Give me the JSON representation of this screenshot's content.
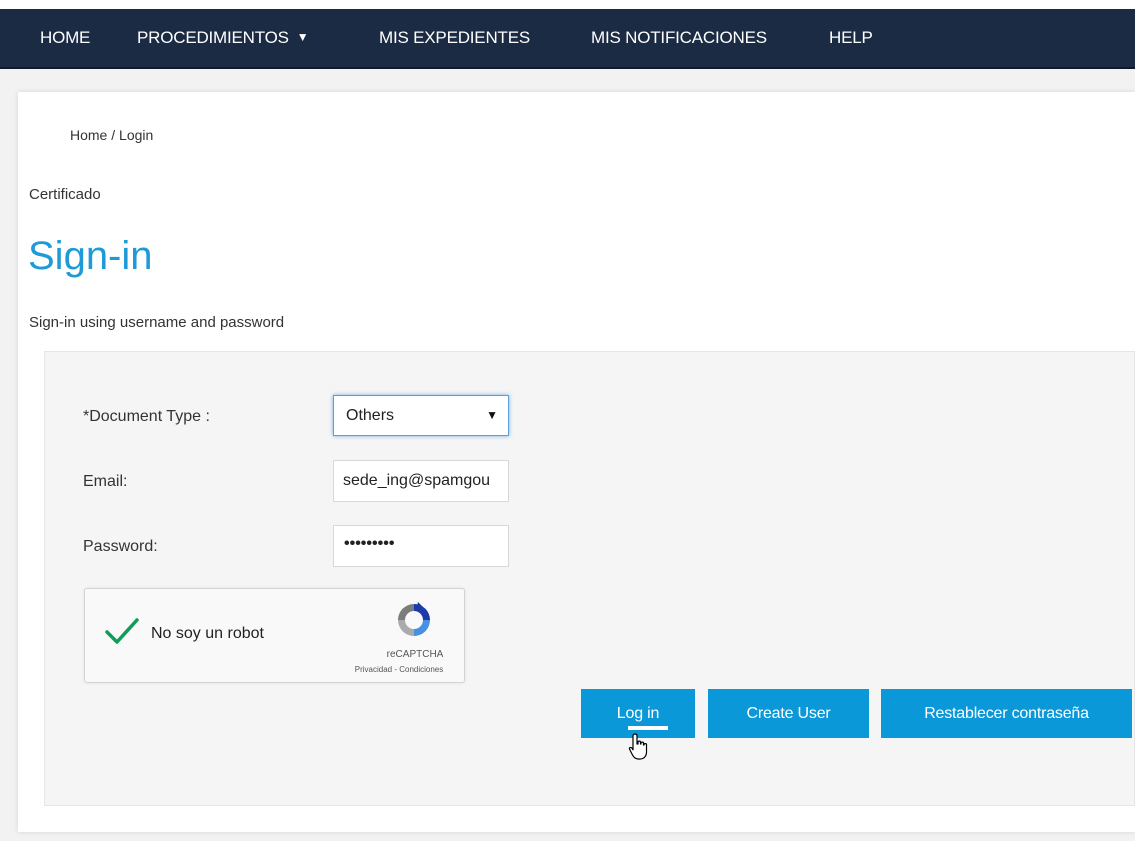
{
  "nav": {
    "home": "HOME",
    "procedimientos": "PROCEDIMIENTOS",
    "procedimientos_arrow": "▼",
    "expedientes": "MIS EXPEDIENTES",
    "notificaciones": "MIS NOTIFICACIONES",
    "help": "HELP"
  },
  "breadcrumb": {
    "home": "Home",
    "separator": " / ",
    "current": "Login"
  },
  "certificado": "Certificado",
  "page": {
    "title": "Sign-in",
    "subtitle": "Sign-in using username and password"
  },
  "form": {
    "document_type_label": "*Document Type :",
    "document_type_value": "Others",
    "email_label": "Email:",
    "email_value": "sede_ing@spamgou",
    "password_label": "Password:",
    "password_masked": "•••••••••"
  },
  "captcha": {
    "label": "No soy un robot",
    "brand": "reCAPTCHA",
    "links": "Privacidad - Condiciones",
    "checked": true
  },
  "buttons": {
    "login": "Log in",
    "create_user": "Create User",
    "reset_password": "Restablecer contraseña"
  },
  "colors": {
    "navbar": "#1c2b44",
    "accent": "#0a98d8",
    "title": "#1e9ad6",
    "check": "#0f9d58"
  }
}
